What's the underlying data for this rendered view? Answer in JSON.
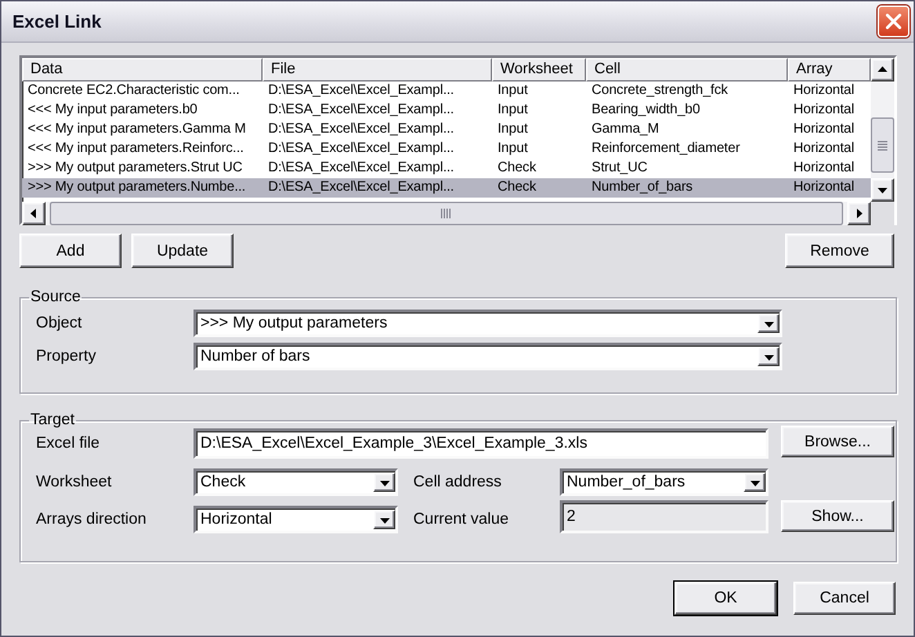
{
  "window": {
    "title": "Excel Link"
  },
  "links_table": {
    "columns": [
      "Data",
      "File",
      "Worksheet",
      "Cell",
      "Array"
    ],
    "rows": [
      {
        "cells": [
          "Concrete EC2.Characteristic com...",
          "D:\\ESA_Excel\\Excel_Exampl...",
          "Input",
          "Concrete_strength_fck",
          "Horizontal"
        ],
        "selected": false
      },
      {
        "cells": [
          "<<< My input parameters.b0",
          "D:\\ESA_Excel\\Excel_Exampl...",
          "Input",
          "Bearing_width_b0",
          "Horizontal"
        ],
        "selected": false
      },
      {
        "cells": [
          "<<< My input parameters.Gamma M",
          "D:\\ESA_Excel\\Excel_Exampl...",
          "Input",
          "Gamma_M",
          "Horizontal"
        ],
        "selected": false
      },
      {
        "cells": [
          "<<< My input parameters.Reinforc...",
          "D:\\ESA_Excel\\Excel_Exampl...",
          "Input",
          "Reinforcement_diameter",
          "Horizontal"
        ],
        "selected": false
      },
      {
        "cells": [
          ">>> My output parameters.Strut UC",
          "D:\\ESA_Excel\\Excel_Exampl...",
          "Check",
          "Strut_UC",
          "Horizontal"
        ],
        "selected": false
      },
      {
        "cells": [
          ">>> My output parameters.Numbe...",
          "D:\\ESA_Excel\\Excel_Exampl...",
          "Check",
          "Number_of_bars",
          "Horizontal"
        ],
        "selected": true
      }
    ]
  },
  "list_buttons": {
    "add": "Add",
    "update": "Update",
    "remove": "Remove"
  },
  "source": {
    "title": "Source",
    "object": {
      "label": "Object",
      "value": ">>> My output parameters"
    },
    "property": {
      "label": "Property",
      "value": "Number of bars"
    }
  },
  "target": {
    "title": "Target",
    "excel_file": {
      "label": "Excel file",
      "value": "D:\\ESA_Excel\\Excel_Example_3\\Excel_Example_3.xls"
    },
    "browse_button": "Browse...",
    "worksheet": {
      "label": "Worksheet",
      "value": "Check"
    },
    "cell_address": {
      "label": "Cell address",
      "value": "Number_of_bars"
    },
    "arrays_direction": {
      "label": "Arrays direction",
      "value": "Horizontal"
    },
    "current_value": {
      "label": "Current value",
      "value": "2",
      "disabled": true
    },
    "show_button": "Show..."
  },
  "buttons": [
    {
      "label": "OK",
      "default": true
    },
    {
      "label": "Cancel",
      "default": false
    }
  ]
}
